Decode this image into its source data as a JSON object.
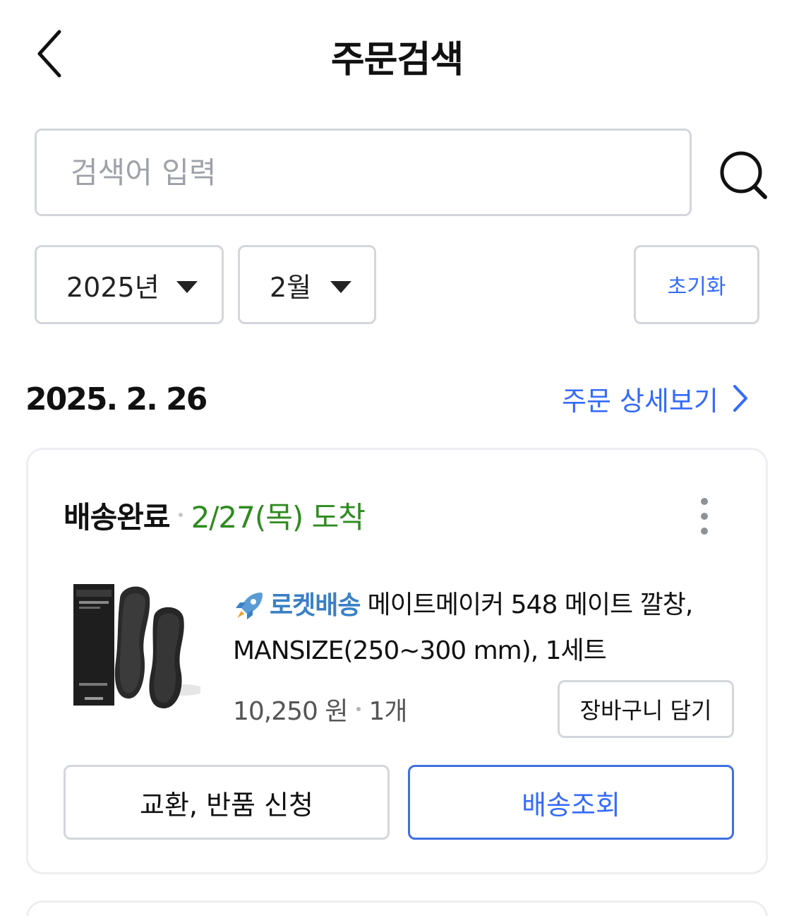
{
  "header": {
    "title": "주문검색"
  },
  "search": {
    "placeholder": "검색어 입력",
    "value": ""
  },
  "filters": {
    "year": "2025년",
    "month": "2월",
    "reset_label": "초기화"
  },
  "order": {
    "date": "2025. 2. 26",
    "detail_link": "주문 상세보기",
    "status": "배송완료",
    "arrival": "2/27(목) 도착",
    "rocket_label": "로켓배송",
    "product_name": "메이트메이커 548 메이트 깔창, MANSIZE(250~300 mm), 1세트",
    "price": "10,250 원",
    "quantity": "1개",
    "cart_label": "장바구니 담기",
    "return_label": "교환, 반품 신청",
    "track_label": "배송조회"
  },
  "colors": {
    "accent_blue": "#346aff",
    "arrival_green": "#2e8b1f",
    "rocket_blue": "#3a80c6",
    "border": "#d3d6db"
  },
  "icons": [
    "back-arrow-icon",
    "search-icon",
    "caret-down-icon",
    "chevron-right-icon",
    "more-vertical-icon",
    "rocket-icon"
  ]
}
